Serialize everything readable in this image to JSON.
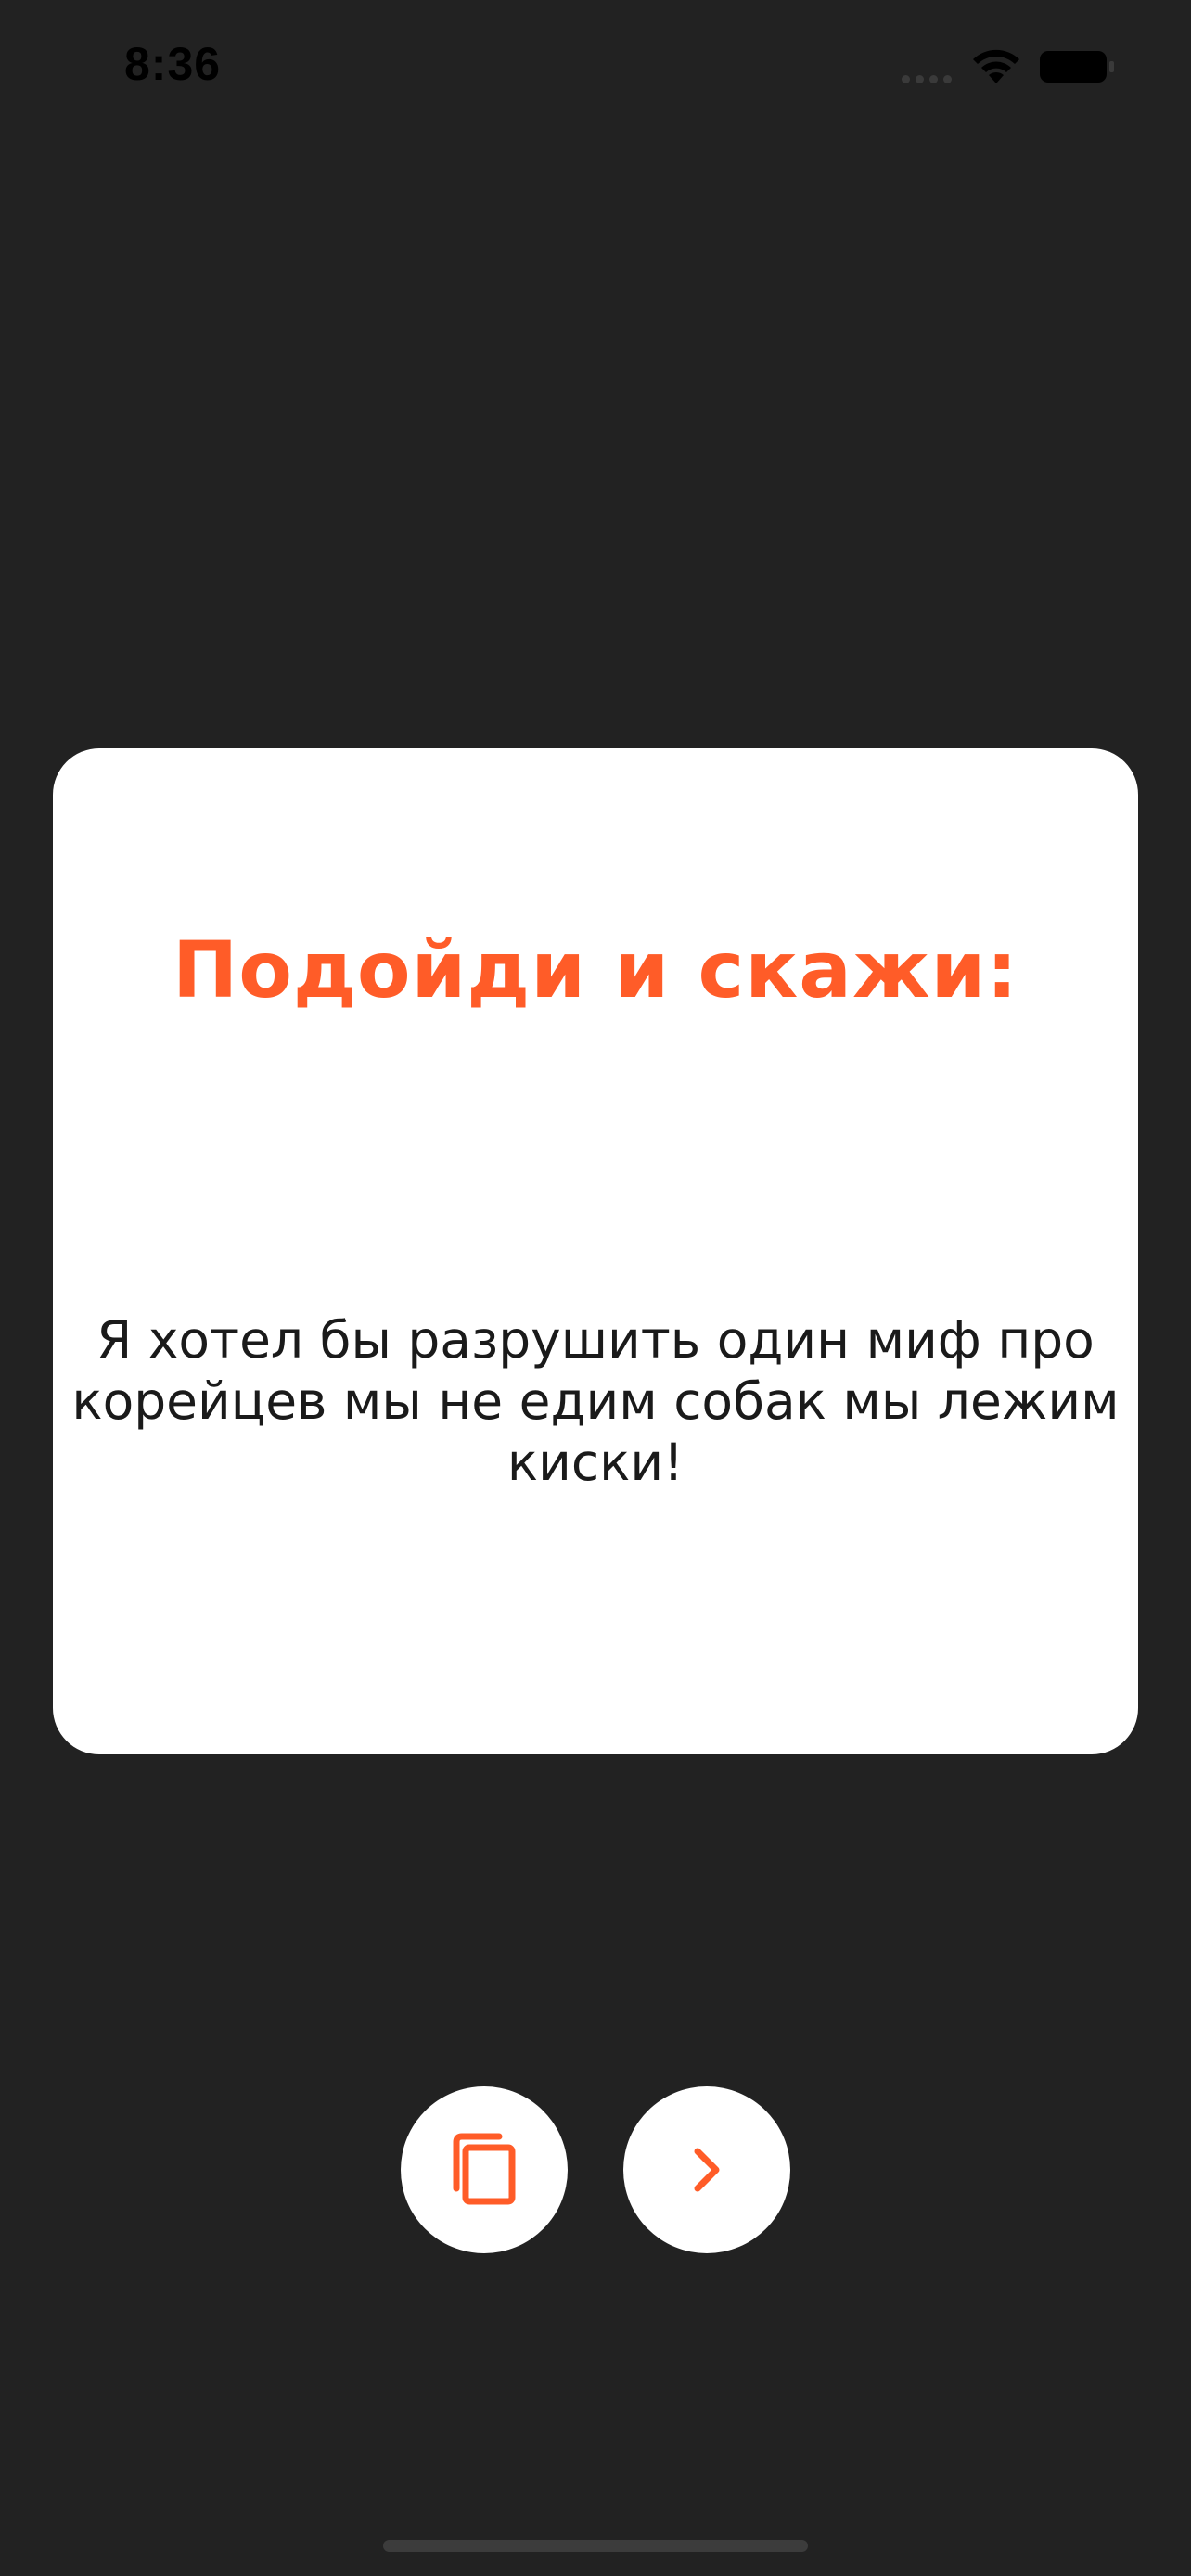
{
  "status_bar": {
    "time": "8:36"
  },
  "card": {
    "title": "Подойди и скажи:",
    "message": "Я хотел бы разрушить один миф про корейцев мы не едим собак мы лежим киски!"
  },
  "actions": {
    "copy_icon": "copy-icon",
    "next_icon": "chevron-right-icon"
  },
  "colors": {
    "background": "#222222",
    "accent": "#FF5C28",
    "card": "#FFFFFF",
    "text": "#1A1A1A"
  }
}
